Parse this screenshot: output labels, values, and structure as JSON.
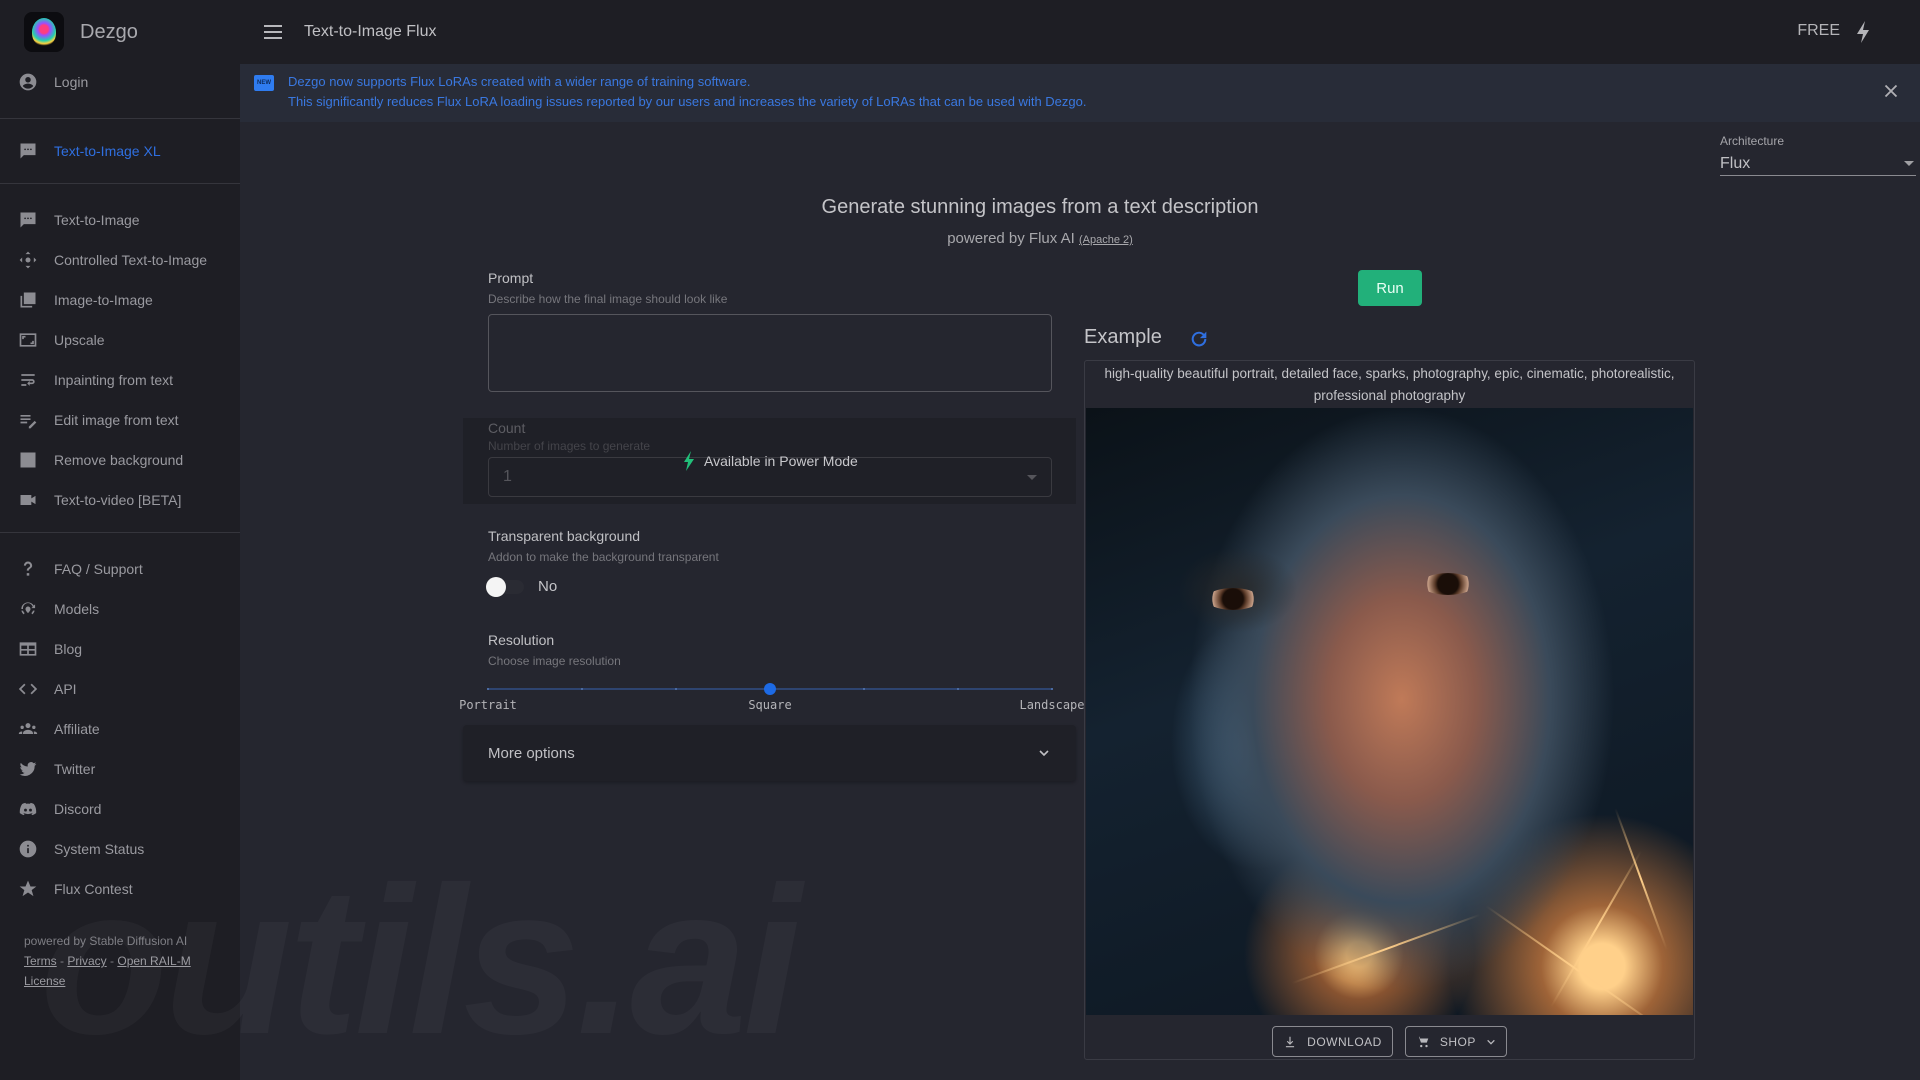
{
  "app": {
    "brand": "Dezgo",
    "page_title": "Text-to-Image Flux",
    "plan_label": "FREE"
  },
  "sidebar": {
    "login": {
      "label": "Login",
      "icon": "account-circle-icon"
    },
    "featured": [
      {
        "label": "Text-to-Image XL",
        "icon": "chat-bubble-icon",
        "active": true
      }
    ],
    "tools": [
      {
        "label": "Text-to-Image",
        "icon": "chat-bubble-icon"
      },
      {
        "label": "Controlled Text-to-Image",
        "icon": "control-move-icon"
      },
      {
        "label": "Image-to-Image",
        "icon": "photo-library-icon"
      },
      {
        "label": "Upscale",
        "icon": "fullscreen-frame-icon"
      },
      {
        "label": "Inpainting from text",
        "icon": "wrap-text-icon"
      },
      {
        "label": "Edit image from text",
        "icon": "edit-note-icon"
      },
      {
        "label": "Remove background",
        "icon": "image-off-icon"
      },
      {
        "label": "Text-to-video [BETA]",
        "icon": "videocam-icon"
      }
    ],
    "links": [
      {
        "label": "FAQ / Support",
        "icon": "question-mark-icon"
      },
      {
        "label": "Models",
        "icon": "models-icon"
      },
      {
        "label": "Blog",
        "icon": "newspaper-icon"
      },
      {
        "label": "API",
        "icon": "code-icon"
      },
      {
        "label": "Affiliate",
        "icon": "groups-icon"
      },
      {
        "label": "Twitter",
        "icon": "twitter-icon"
      },
      {
        "label": "Discord",
        "icon": "discord-icon"
      },
      {
        "label": "System Status",
        "icon": "info-icon"
      },
      {
        "label": "Flux Contest",
        "icon": "star-icon"
      }
    ],
    "footer": {
      "powered_by": "powered by Stable Diffusion AI",
      "terms": "Terms",
      "sep1": " - ",
      "privacy": "Privacy",
      "sep2": " - ",
      "license": "Open RAIL-M License"
    }
  },
  "banner": {
    "badge": "NEW",
    "line1": "Dezgo now supports Flux LoRAs created with a wider range of training software.",
    "line2": "This significantly reduces Flux LoRA loading issues reported by our users and increases the variety of LoRAs that can be used with Dezgo."
  },
  "architecture": {
    "label": "Architecture",
    "value": "Flux"
  },
  "hero": {
    "title": "Generate stunning images from a text description",
    "subtitle": "powered by Flux AI",
    "license_link": "(Apache 2)"
  },
  "form": {
    "prompt": {
      "label": "Prompt",
      "hint": "Describe how the final image should look like",
      "value": "",
      "placeholder": ""
    },
    "count": {
      "label": "Count",
      "hint": "Number of images to generate",
      "value": "1",
      "disabled": true,
      "overlay": "Available in Power Mode"
    },
    "transparent": {
      "label": "Transparent background",
      "hint": "Addon to make the background transparent",
      "state_label": "No",
      "enabled": false
    },
    "resolution": {
      "label": "Resolution",
      "hint": "Choose image resolution",
      "steps": 7,
      "selected_index": 3,
      "labels": [
        "Portrait",
        "Square",
        "Landscape"
      ]
    },
    "more_options": "More options"
  },
  "run_button": "Run",
  "example": {
    "title": "Example",
    "caption": "high-quality beautiful portrait, detailed face, sparks, photography, epic, cinematic, photorealistic, professional photography",
    "download": "DOWNLOAD",
    "shop": "SHOP"
  },
  "watermark": "outils.ai",
  "colors": {
    "accent_blue": "#2f6fe0",
    "run_green": "#22b07a",
    "power_green": "#22c07a"
  }
}
